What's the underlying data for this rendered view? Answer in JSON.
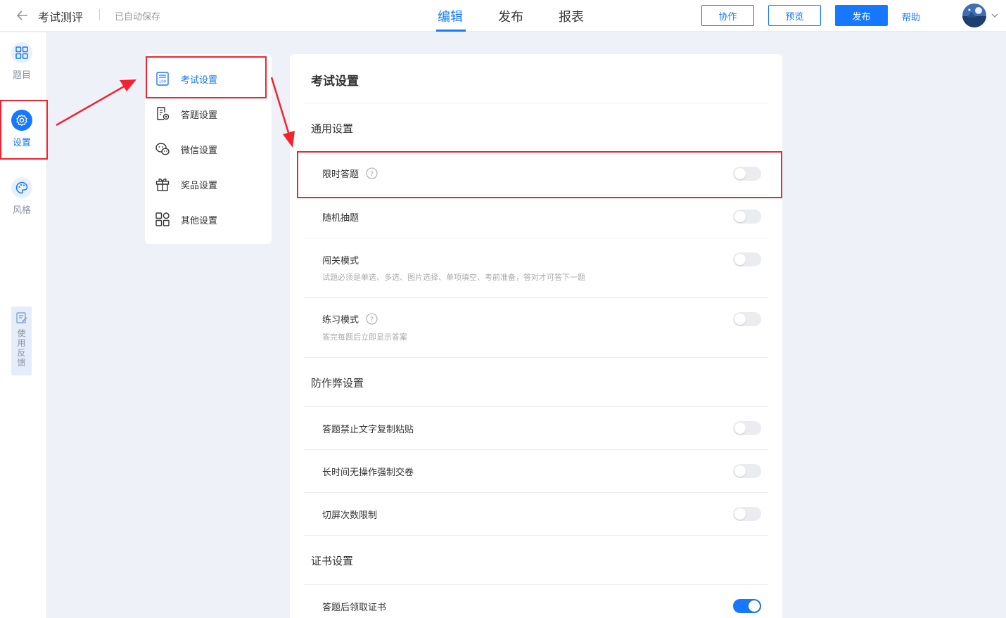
{
  "header": {
    "title": "考试测评",
    "autosave": "已自动保存",
    "tabs": [
      "编辑",
      "发布",
      "报表"
    ],
    "buttons": {
      "collaborate": "协作",
      "preview": "预览",
      "publish": "发布"
    },
    "help": "帮助"
  },
  "rail": {
    "items": [
      "题目",
      "设置",
      "风格"
    ],
    "feedback": "使用反馈"
  },
  "submenu": {
    "items": [
      "考试设置",
      "答题设置",
      "微信设置",
      "奖品设置",
      "其他设置"
    ]
  },
  "panel": {
    "title": "考试设置",
    "sections": {
      "general": "通用设置",
      "anticheat": "防作弊设置",
      "certificate": "证书设置"
    },
    "rows": {
      "timed": "限时答题",
      "random": "随机抽题",
      "level": "闯关模式",
      "level_desc": "试题必须是单选、多选、图片选择、单项填空、考前准备，答对才可答下一题",
      "practice": "练习模式",
      "practice_desc": "答完每题后立即显示答案",
      "nocopy": "答题禁止文字复制粘贴",
      "idle": "长时间无操作强制交卷",
      "switch": "切屏次数限制",
      "cert": "答题后领取证书"
    }
  },
  "colors": {
    "accent": "#1677ff",
    "highlight": "#f5222d"
  }
}
